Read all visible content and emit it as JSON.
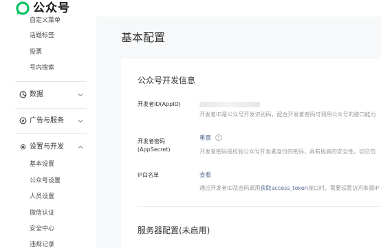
{
  "brand": {
    "name": "公众号",
    "color": "#07c160"
  },
  "sidebar": {
    "top_items": [
      {
        "label": "自定义菜单"
      },
      {
        "label": "话题标签"
      },
      {
        "label": "投票"
      },
      {
        "label": "号内搜索"
      }
    ],
    "groups": [
      {
        "label": "数据",
        "icon": "pie-chart-icon",
        "expanded": false
      },
      {
        "label": "广告与服务",
        "icon": "compass-icon",
        "expanded": false
      },
      {
        "label": "设置与开发",
        "icon": "gear-icon",
        "expanded": true
      }
    ],
    "settings_items": [
      {
        "label": "基本设置"
      },
      {
        "label": "公众号设置"
      },
      {
        "label": "人员设置"
      },
      {
        "label": "微信认证"
      },
      {
        "label": "安全中心"
      },
      {
        "label": "违规记录"
      }
    ]
  },
  "main": {
    "page_title": "基本配置",
    "dev_info": {
      "title": "公众号开发信息",
      "appid_label": "开发者ID(AppID)",
      "appid_desc": "开发者ID是公众号开发识别码，配合开发者密码可调用公众号的接口能力",
      "secret_label": "开发者密码(AppSecret)",
      "secret_action": "重置",
      "secret_desc": "开发者密码是校验公众号开发者身份的密码，具有极高的安全性。切记勿",
      "ip_label": "IP白名单",
      "ip_action": "查看",
      "ip_desc_before": "通过开发者ID及密码调用",
      "ip_desc_link": "获取access_token",
      "ip_desc_after": "接口时，需要设置访问来源IP"
    },
    "server": {
      "title": "服务器配置(未启用)"
    }
  }
}
